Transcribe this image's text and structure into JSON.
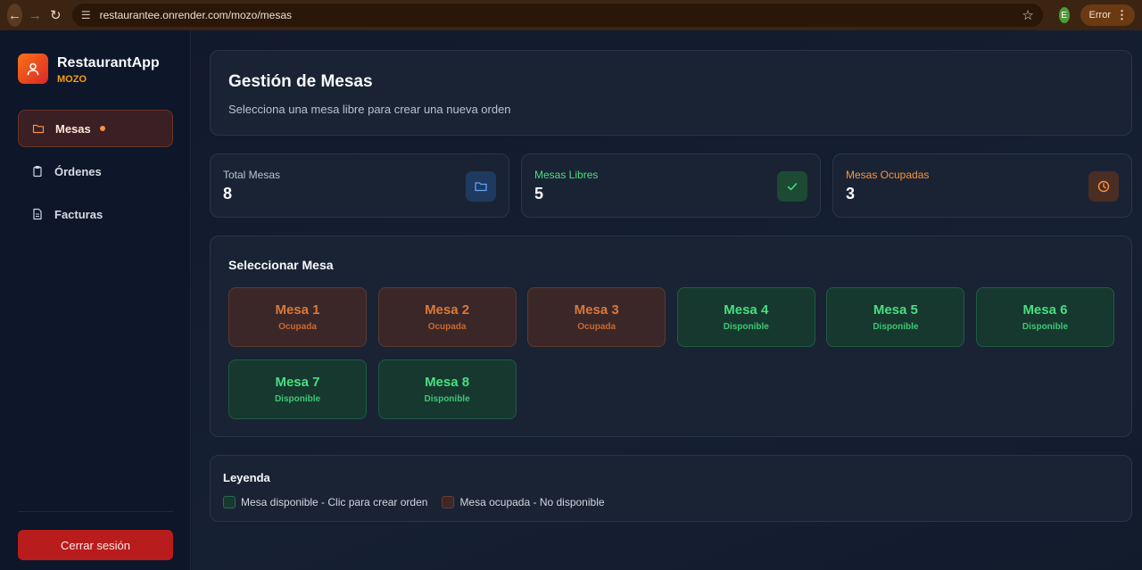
{
  "browser": {
    "url": "restaurantee.onrender.com/mozo/mesas",
    "profile_initial": "E",
    "error_label": "Error"
  },
  "sidebar": {
    "app_name": "RestaurantApp",
    "role": "MOZO",
    "items": [
      {
        "label": "Mesas",
        "icon": "folder-icon",
        "active": true
      },
      {
        "label": "Órdenes",
        "icon": "clipboard-icon",
        "active": false
      },
      {
        "label": "Facturas",
        "icon": "document-icon",
        "active": false
      }
    ],
    "logout_label": "Cerrar sesión"
  },
  "header": {
    "title": "Gestión de Mesas",
    "subtitle": "Selecciona una mesa libre para crear una nueva orden"
  },
  "stats": [
    {
      "label": "Total Mesas",
      "value": "8",
      "icon": "folder-icon",
      "color": "#60a5fa"
    },
    {
      "label": "Mesas Libres",
      "value": "5",
      "icon": "check-icon",
      "color": "#4ade80"
    },
    {
      "label": "Mesas Ocupadas",
      "value": "3",
      "icon": "clock-icon",
      "color": "#fb923c"
    }
  ],
  "tables_section": {
    "title": "Seleccionar Mesa",
    "tables": [
      {
        "name": "Mesa 1",
        "status": "Ocupada",
        "state": "busy"
      },
      {
        "name": "Mesa 2",
        "status": "Ocupada",
        "state": "busy"
      },
      {
        "name": "Mesa 3",
        "status": "Ocupada",
        "state": "busy"
      },
      {
        "name": "Mesa 4",
        "status": "Disponible",
        "state": "free"
      },
      {
        "name": "Mesa 5",
        "status": "Disponible",
        "state": "free"
      },
      {
        "name": "Mesa 6",
        "status": "Disponible",
        "state": "free"
      },
      {
        "name": "Mesa 7",
        "status": "Disponible",
        "state": "free"
      },
      {
        "name": "Mesa 8",
        "status": "Disponible",
        "state": "free"
      }
    ]
  },
  "legend": {
    "title": "Leyenda",
    "free_label": "Mesa disponible - Clic para crear orden",
    "busy_label": "Mesa ocupada - No disponible"
  }
}
